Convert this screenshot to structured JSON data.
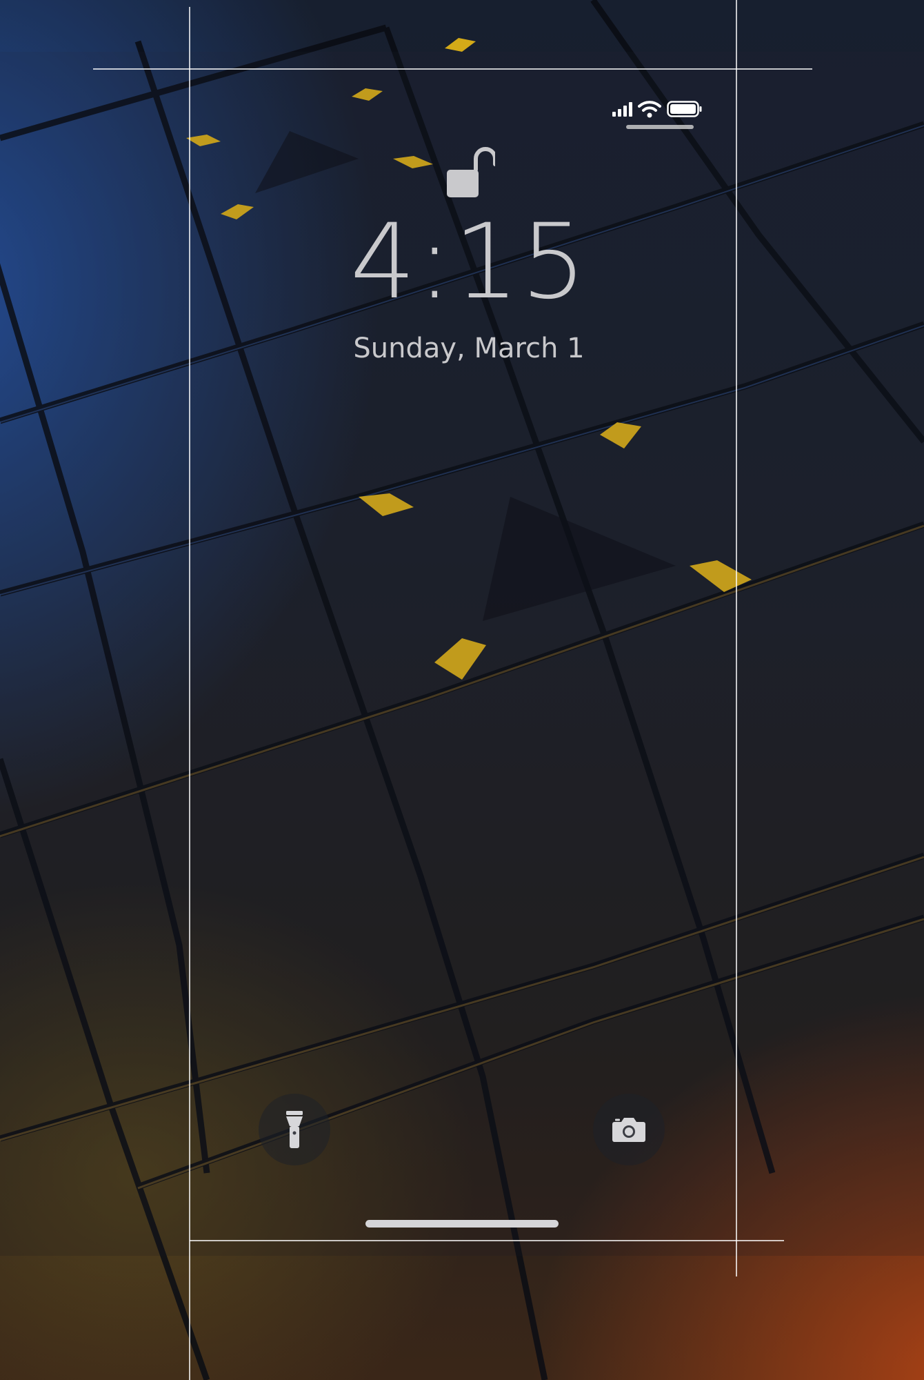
{
  "lock_screen": {
    "time": "4:15",
    "date": "Sunday, March 1",
    "lock_state": "unlocked"
  },
  "status_bar": {
    "signal_bars": 4,
    "wifi": true,
    "battery_level": 1.0
  },
  "quick_actions": {
    "left_icon": "flashlight-icon",
    "right_icon": "camera-icon"
  },
  "colors": {
    "text": "#c9c9cc",
    "accent_yellow": "#f2c21a",
    "wallpaper_blue": "#2a5fbe",
    "wallpaper_orange": "#be4614"
  }
}
